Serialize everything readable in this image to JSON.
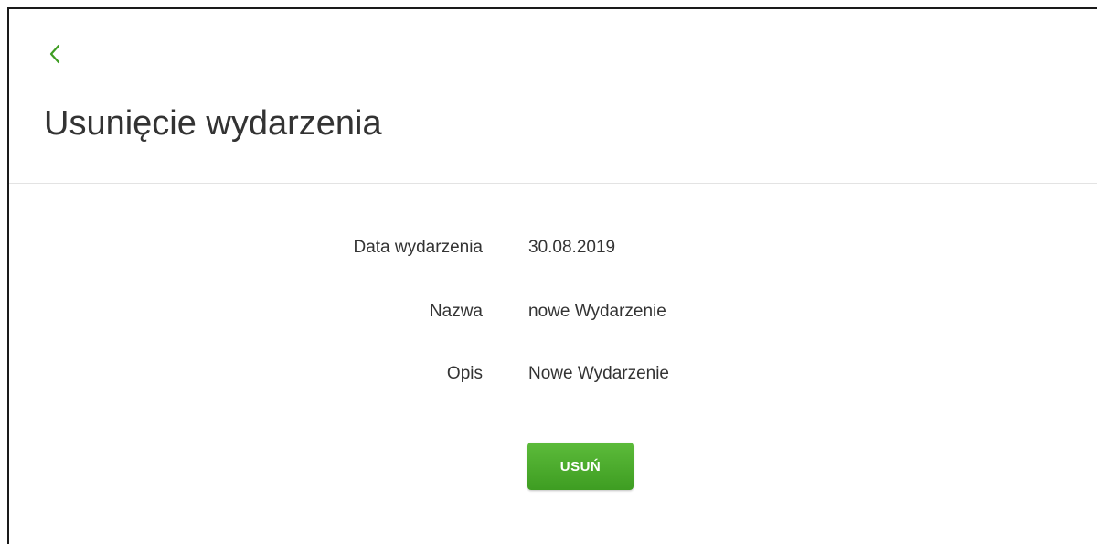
{
  "header": {
    "back_icon": "chevron-left-icon",
    "title": "Usunięcie wydarzenia"
  },
  "details": {
    "date": {
      "label": "Data wydarzenia",
      "value": "30.08.2019"
    },
    "name": {
      "label": "Nazwa",
      "value": "nowe Wydarzenie"
    },
    "description": {
      "label": "Opis",
      "value": "Nowe Wydarzenie"
    }
  },
  "actions": {
    "delete_label": "USUŃ"
  },
  "colors": {
    "accent": "#3e9d22",
    "accent_light": "#5cbb3a",
    "text": "#333333",
    "divider": "#e3e3e3"
  }
}
